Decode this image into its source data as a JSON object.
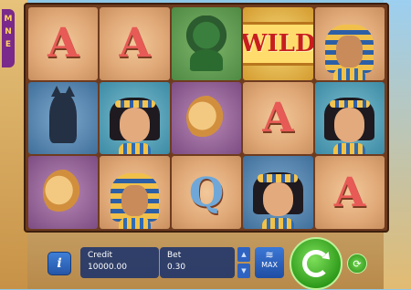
{
  "game": {
    "logo_fragment": "M\nN\nE"
  },
  "reels": [
    [
      {
        "symbol": "A",
        "bg": "sand"
      },
      {
        "symbol": "A",
        "bg": "sand"
      },
      {
        "symbol": "cobra",
        "bg": "green"
      },
      {
        "symbol": "WILD",
        "bg": "gold"
      },
      {
        "symbol": "pharaoh",
        "bg": "sand"
      }
    ],
    [
      {
        "symbol": "cat",
        "bg": "blue"
      },
      {
        "symbol": "cleopatra",
        "bg": "teal"
      },
      {
        "symbol": "falcon",
        "bg": "purple"
      },
      {
        "symbol": "A",
        "bg": "sand"
      },
      {
        "symbol": "cleopatra",
        "bg": "teal"
      }
    ],
    [
      {
        "symbol": "falcon",
        "bg": "purple"
      },
      {
        "symbol": "pharaoh",
        "bg": "sand"
      },
      {
        "symbol": "Q",
        "bg": "sand"
      },
      {
        "symbol": "cleopatra",
        "bg": "blue"
      },
      {
        "symbol": "A",
        "bg": "sand"
      }
    ]
  ],
  "controls": {
    "info_label": "i",
    "credit_label": "Credit",
    "credit_value": "10000.00",
    "bet_label": "Bet",
    "bet_value": "0.30",
    "bet_up": "▲",
    "bet_down": "▼",
    "max_label": "MAX",
    "max_icon": "≋",
    "spin_icon": "spin-arrows-icon",
    "autoplay_icon": "⟳"
  },
  "colors": {
    "spin_green": "#2f9b1b",
    "panel_blue": "#16306c",
    "wild_red": "#c81e1e"
  }
}
